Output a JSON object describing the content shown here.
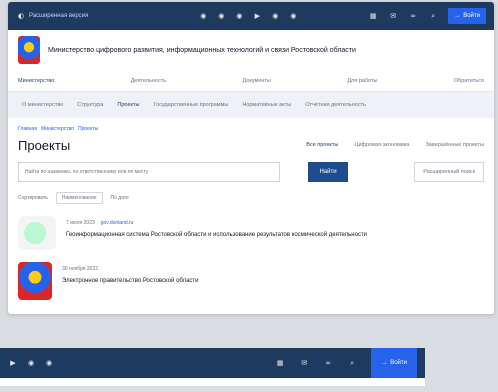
{
  "topbar": {
    "special_version": "Расширенная версия",
    "login": "Войти"
  },
  "header": {
    "org_name": "Министерство цифрового развития, информационных технологий и связи Ростовской области"
  },
  "main_nav": [
    "Министерство",
    "Деятельность",
    "Документы",
    "Для работы",
    "Обратиться"
  ],
  "sub_nav": [
    "О министерстве",
    "Структура",
    "Проекты",
    "Государственные программы",
    "Нормативные акты",
    "Отчётная деятельность"
  ],
  "breadcrumb": [
    "Главная",
    "Министерство",
    "Проекты"
  ],
  "page": {
    "title": "Проекты",
    "tabs": [
      "Все проекты",
      "Цифровая экономика",
      "Завершённые проекты"
    ]
  },
  "search": {
    "placeholder": "Найти по названию, по ответственному или по месту",
    "find_label": "Найти",
    "advanced_label": "Расширенный поиск"
  },
  "sort": {
    "label": "Сортировать",
    "by_name": "Наименование",
    "by_date": "По дате"
  },
  "projects": [
    {
      "date": "7 июля 2023",
      "org": "gov.donland.ru",
      "title": "Геоинформационная система Ростовской области и использование результатов космической деятельности"
    },
    {
      "date": "30 ноября 2022",
      "org": "",
      "title": "Электронное правительство Ростовской области"
    }
  ],
  "strip": {
    "login": "Войти"
  }
}
